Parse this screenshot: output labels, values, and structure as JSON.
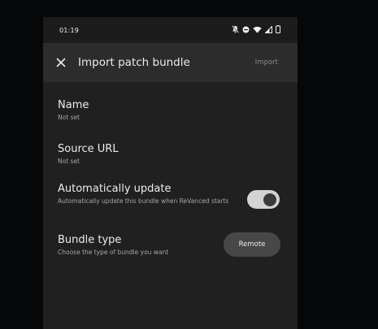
{
  "status_bar": {
    "time": "01:19",
    "icons": [
      "notifications-off-icon",
      "do-not-disturb-icon",
      "wifi-icon",
      "signal-icon",
      "battery-icon"
    ]
  },
  "top_bar": {
    "close_icon": "close-icon",
    "title": "Import patch bundle",
    "action_label": "Import"
  },
  "settings": [
    {
      "title": "Name",
      "subtitle": "Not set"
    },
    {
      "title": "Source URL",
      "subtitle": "Not set"
    },
    {
      "title": "Automatically update",
      "subtitle": "Automatically update this bundle when ReVanced starts",
      "toggle_on": true
    },
    {
      "title": "Bundle type",
      "subtitle": "Choose the type of bundle you want",
      "button_label": "Remote"
    }
  ],
  "colors": {
    "surface": "#202020",
    "top_bar": "#2c2c2c",
    "toggle_track": "#d3d3d3",
    "toggle_knob": "#3a3a3a",
    "button": "#474747"
  }
}
